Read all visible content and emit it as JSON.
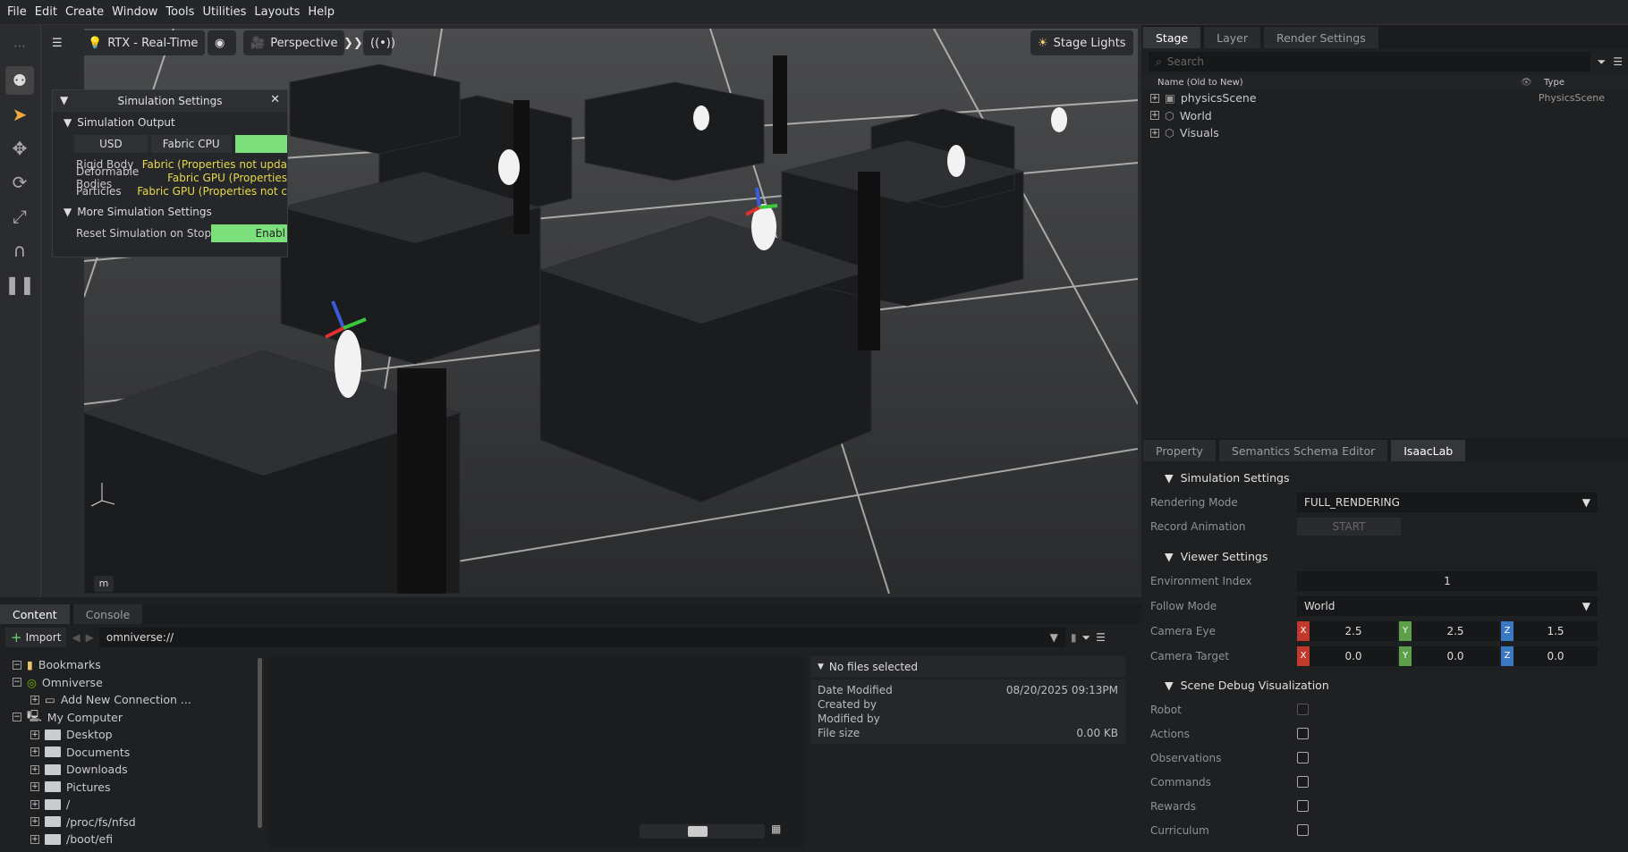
{
  "menu": [
    "File",
    "Edit",
    "Create",
    "Window",
    "Tools",
    "Utilities",
    "Layouts",
    "Help"
  ],
  "viewport": {
    "render_mode": "RTX - Real-Time",
    "camera": "Perspective",
    "lights": "Stage Lights",
    "unit": "m"
  },
  "sim_settings": {
    "title": "Simulation Settings",
    "output_section": "Simulation Output",
    "modes": [
      "USD",
      "Fabric CPU"
    ],
    "rows": [
      {
        "label": "Rigid Body",
        "value": "Fabric (Properties not upda"
      },
      {
        "label": "Deformable Bodies",
        "value": "Fabric GPU (Properties"
      },
      {
        "label": "Particles",
        "value": "Fabric GPU (Properties not c"
      }
    ],
    "more_section": "More Simulation Settings",
    "reset_label": "Reset Simulation on Stop",
    "reset_value": "Enabl"
  },
  "stage": {
    "tabs": [
      "Stage",
      "Layer",
      "Render Settings"
    ],
    "search_placeholder": "Search",
    "col_name": "Name (Old to New)",
    "col_type": "Type",
    "items": [
      {
        "name": "physicsScene",
        "type": "PhysicsScene"
      },
      {
        "name": "World",
        "type": ""
      },
      {
        "name": "Visuals",
        "type": ""
      }
    ]
  },
  "props": {
    "tabs": [
      "Property",
      "Semantics Schema Editor",
      "IsaacLab"
    ],
    "sim_section": "Simulation Settings",
    "rendering_mode_label": "Rendering Mode",
    "rendering_mode": "FULL_RENDERING",
    "record_label": "Record Animation",
    "record_btn": "START",
    "viewer_section": "Viewer Settings",
    "env_index_label": "Environment Index",
    "env_index": "1",
    "follow_label": "Follow Mode",
    "follow": "World",
    "eye_label": "Camera Eye",
    "eye": [
      "2.5",
      "2.5",
      "1.5"
    ],
    "target_label": "Camera Target",
    "target": [
      "0.0",
      "0.0",
      "0.0"
    ],
    "debug_section": "Scene Debug Visualization",
    "debug_items": [
      "Robot",
      "Actions",
      "Observations",
      "Commands",
      "Rewards",
      "Curriculum"
    ]
  },
  "content": {
    "tabs": [
      "Content",
      "Console"
    ],
    "import": "Import",
    "path": "omniverse://",
    "tree": [
      {
        "label": "Bookmarks",
        "level": 0,
        "icon": "bookmark-icon"
      },
      {
        "label": "Omniverse",
        "level": 0,
        "icon": "omniverse-icon"
      },
      {
        "label": "Add New Connection ...",
        "level": 1,
        "icon": "connection-icon"
      },
      {
        "label": "My Computer",
        "level": 0,
        "icon": "computer-icon"
      },
      {
        "label": "Desktop",
        "level": 1,
        "icon": "folder-icon"
      },
      {
        "label": "Documents",
        "level": 1,
        "icon": "folder-icon"
      },
      {
        "label": "Downloads",
        "level": 1,
        "icon": "folder-icon"
      },
      {
        "label": "Pictures",
        "level": 1,
        "icon": "folder-icon"
      },
      {
        "label": "/",
        "level": 1,
        "icon": "folder-icon"
      },
      {
        "label": "/proc/fs/nfsd",
        "level": 1,
        "icon": "folder-icon"
      },
      {
        "label": "/boot/efi",
        "level": 1,
        "icon": "folder-icon"
      }
    ],
    "details_title": "No files selected",
    "details": [
      {
        "k": "Date Modified",
        "v": "08/20/2025 09:13PM"
      },
      {
        "k": "Created by",
        "v": ""
      },
      {
        "k": "Modified by",
        "v": ""
      },
      {
        "k": "File size",
        "v": "0.00 KB"
      }
    ]
  },
  "colors": {
    "accent_green": "#6fd36f",
    "x": "#c0392b",
    "y": "#5ea04a",
    "z": "#3b78c4"
  }
}
